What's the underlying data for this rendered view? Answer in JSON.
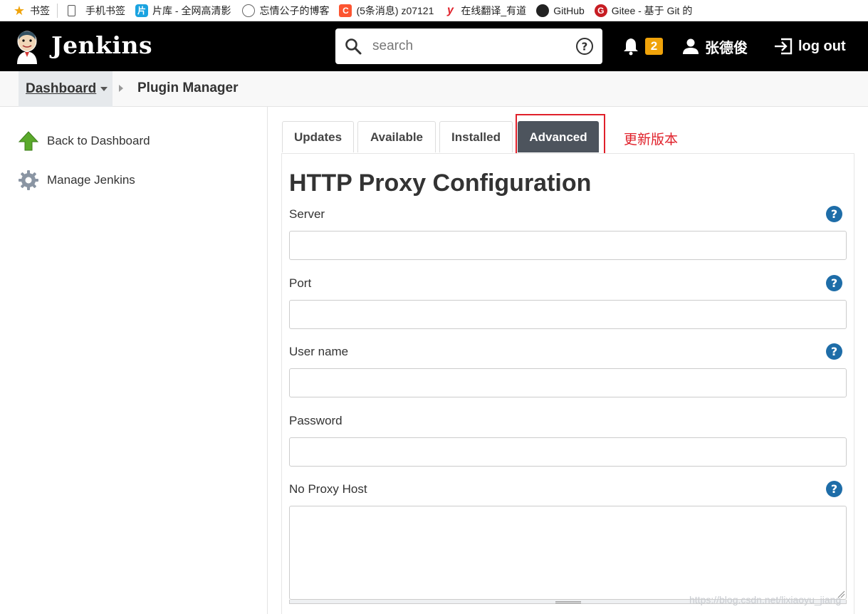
{
  "bookmarks": [
    {
      "label": "书签",
      "icon": "star-icon"
    },
    {
      "label": "手机书签",
      "icon": "phone-icon"
    },
    {
      "label": "片库 - 全网高清影",
      "icon": "pianku-icon"
    },
    {
      "label": "忘情公子的博客",
      "icon": "globe-icon"
    },
    {
      "label": "(5条消息) z07121",
      "icon": "csdn-icon"
    },
    {
      "label": "在线翻译_有道",
      "icon": "youdao-icon"
    },
    {
      "label": "GitHub",
      "icon": "github-icon"
    },
    {
      "label": "Gitee - 基于 Git 的",
      "icon": "gitee-icon"
    }
  ],
  "header": {
    "brand": "Jenkins",
    "search_placeholder": "search",
    "notification_count": "2",
    "username": "张德俊",
    "logout_label": "log out"
  },
  "breadcrumb": {
    "dashboard": "Dashboard",
    "current": "Plugin Manager"
  },
  "sidebar": {
    "items": [
      {
        "label": "Back to Dashboard",
        "icon": "up-arrow-icon"
      },
      {
        "label": "Manage Jenkins",
        "icon": "gear-icon"
      }
    ]
  },
  "tabs": [
    {
      "label": "Updates",
      "active": false
    },
    {
      "label": "Available",
      "active": false
    },
    {
      "label": "Installed",
      "active": false
    },
    {
      "label": "Advanced",
      "active": true
    }
  ],
  "annotation": "更新版本",
  "form": {
    "title": "HTTP Proxy Configuration",
    "fields": [
      {
        "label": "Server",
        "value": ""
      },
      {
        "label": "Port",
        "value": ""
      },
      {
        "label": "User name",
        "value": ""
      },
      {
        "label": "Password",
        "value": ""
      },
      {
        "label": "No Proxy Host",
        "value": ""
      }
    ]
  },
  "watermark": "https://blog.csdn.net/lixiaoyu_jiang",
  "colors": {
    "header_bg": "#000000",
    "badge": "#f0a30a",
    "active_tab": "#4d545d",
    "help_icon": "#1e6da8",
    "annotation": "#e0202a"
  }
}
